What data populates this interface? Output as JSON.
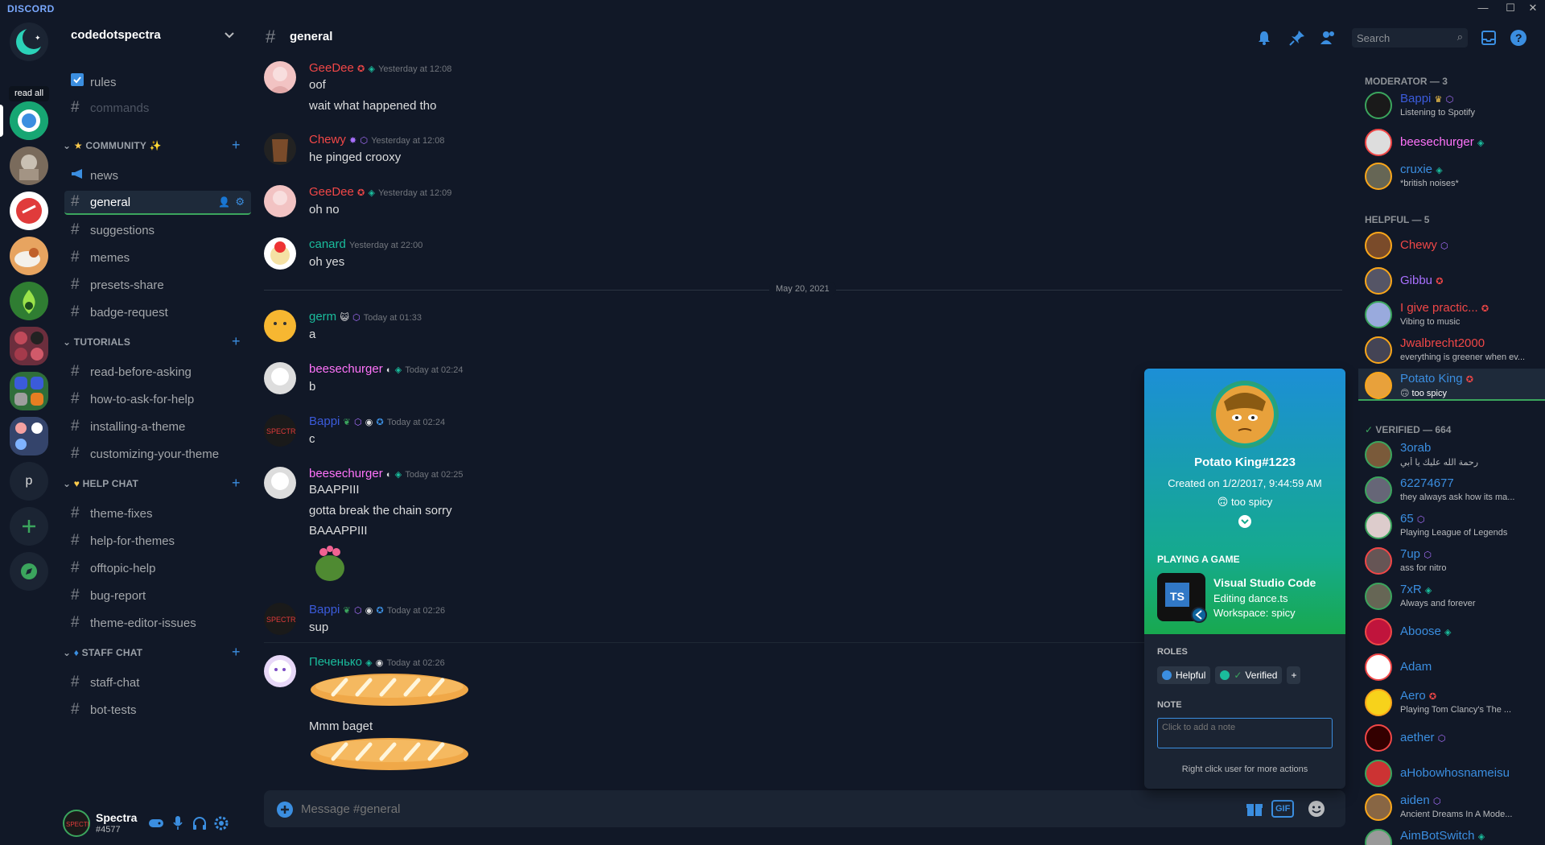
{
  "app": {
    "brand": "DISCORD",
    "read_all": "read all",
    "dm_p": "p"
  },
  "colors": {
    "accent": "#3b8ee0",
    "green": "#3ba55d",
    "moderator": "#3b8ee0",
    "red": "#f04747",
    "teal": "#1abc9c",
    "purple": "#a970ff",
    "pink": "#ff73fa"
  },
  "guild": {
    "name": "codedotspectra"
  },
  "channels": [
    {
      "name": "rules",
      "type": "rules"
    },
    {
      "name": "commands",
      "type": "text",
      "muted": true
    }
  ],
  "categories": [
    {
      "name": "COMMUNITY",
      "emoji": "★",
      "sparkle": "✨",
      "channels": [
        "news",
        "general",
        "suggestions",
        "memes",
        "presets-share",
        "badge-request"
      ]
    },
    {
      "name": "TUTORIALS",
      "channels": [
        "read-before-asking",
        "how-to-ask-for-help",
        "installing-a-theme",
        "customizing-your-theme"
      ]
    },
    {
      "name": "HELP CHAT",
      "channels": [
        "theme-fixes",
        "help-for-themes",
        "offtopic-help",
        "bug-report",
        "theme-editor-issues"
      ]
    },
    {
      "name": "STAFF CHAT",
      "channels": [
        "staff-chat",
        "bot-tests"
      ]
    }
  ],
  "selected_channel": "general",
  "user": {
    "name": "Spectra",
    "tag": "#4577"
  },
  "header": {
    "channel": "general",
    "search_placeholder": "Search"
  },
  "messages": [
    {
      "author": "GeeDee",
      "color": "#f04747",
      "time": "Yesterday at 12:08",
      "lines": [
        "oof",
        "wait what happened tho"
      ]
    },
    {
      "author": "Chewy",
      "color": "#f04747",
      "time": "Yesterday at 12:08",
      "lines": [
        "he pinged crooxy"
      ]
    },
    {
      "author": "GeeDee",
      "color": "#f04747",
      "time": "Yesterday at 12:09",
      "lines": [
        "oh no"
      ]
    },
    {
      "author": "canard",
      "color": "#1abc9c",
      "time": "Yesterday at 22:00",
      "lines": [
        "oh yes"
      ]
    },
    {
      "author": "germ",
      "color": "#1abc9c",
      "time": "Today at 01:33",
      "lines": [
        "a"
      ]
    },
    {
      "author": "beesechurger",
      "color": "#ff73fa",
      "time": "Today at 02:24",
      "lines": [
        "b"
      ]
    },
    {
      "author": "Bappi",
      "color": "#3b5bdb",
      "time": "Today at 02:24",
      "lines": [
        "c"
      ]
    },
    {
      "author": "beesechurger",
      "color": "#ff73fa",
      "time": "Today at 02:25",
      "lines": [
        "BAAPPIII",
        "gotta break the chain sorry",
        "BAAAPPIII"
      ]
    },
    {
      "author": "Bappi",
      "color": "#3b5bdb",
      "time": "Today at 02:26",
      "lines": [
        "sup"
      ]
    },
    {
      "author": "Печенько",
      "color": "#1abc9c",
      "time": "Today at 02:26",
      "lines": [
        "Mmm baget"
      ]
    }
  ],
  "date_divider": "May 20, 2021",
  "composer": {
    "placeholder": "Message #general",
    "gif": "GIF"
  },
  "members": {
    "moderator_title": "MODERATOR — 3",
    "moderators": [
      {
        "name": "Bappi",
        "color": "#3b5bdb",
        "status": "Listening to Spotify"
      },
      {
        "name": "beesechurger",
        "color": "#ff73fa",
        "status": ""
      },
      {
        "name": "cruxie",
        "color": "#3b8ee0",
        "status": "*british noises*"
      }
    ],
    "helpful_title": "HELPFUL — 5",
    "helpful": [
      {
        "name": "Chewy",
        "color": "#f04747",
        "status": ""
      },
      {
        "name": "Gibbu",
        "color": "#a970ff",
        "status": ""
      },
      {
        "name": "I give practic...",
        "color": "#f04747",
        "status": "Vibing to music"
      },
      {
        "name": "Jwalbrecht2000",
        "color": "#f04747",
        "status": "everything is greener when ev..."
      },
      {
        "name": "Potato King",
        "color": "#3b8ee0",
        "status": "too spicy"
      }
    ],
    "verified_title": "VERIFIED — 664",
    "verified": [
      {
        "name": "3orab",
        "color": "#3b8ee0",
        "status": "رحمة الله عليك يا أبي"
      },
      {
        "name": "62274677",
        "color": "#3b8ee0",
        "status": "they always ask how its ma..."
      },
      {
        "name": "65",
        "color": "#3b8ee0",
        "status": "Playing League of Legends"
      },
      {
        "name": "7up",
        "color": "#3b8ee0",
        "status": "ass for nitro"
      },
      {
        "name": "7xR",
        "color": "#3b8ee0",
        "status": "Always and forever"
      },
      {
        "name": "Aboose",
        "color": "#3b8ee0",
        "status": ""
      },
      {
        "name": "Adam",
        "color": "#3b8ee0",
        "status": ""
      },
      {
        "name": "Aero",
        "color": "#3b8ee0",
        "status": "Playing Tom Clancy's The ..."
      },
      {
        "name": "aether",
        "color": "#3b8ee0",
        "status": ""
      },
      {
        "name": "aHobowhosnameisu",
        "color": "#3b8ee0",
        "status": ""
      },
      {
        "name": "aiden",
        "color": "#3b8ee0",
        "status": "Ancient Dreams In A Mode..."
      },
      {
        "name": "AimBotSwitch",
        "color": "#3b8ee0",
        "status": ""
      }
    ]
  },
  "popout": {
    "username": "Potato King#1223",
    "created": "Created on 1/2/2017, 9:44:59 AM",
    "status": "too spicy",
    "activity_title": "PLAYING A GAME",
    "game": "Visual Studio Code",
    "detail1": "Editing dance.ts",
    "detail2": "Workspace: spicy",
    "ts_badge": "TS",
    "roles_title": "ROLES",
    "roles": [
      {
        "name": "Helpful",
        "color": "#3b8ee0"
      },
      {
        "name": "Verified",
        "color": "#1abc9c"
      }
    ],
    "note_title": "NOTE",
    "note_placeholder": "Click to add a note",
    "hint": "Right click user for more actions"
  }
}
